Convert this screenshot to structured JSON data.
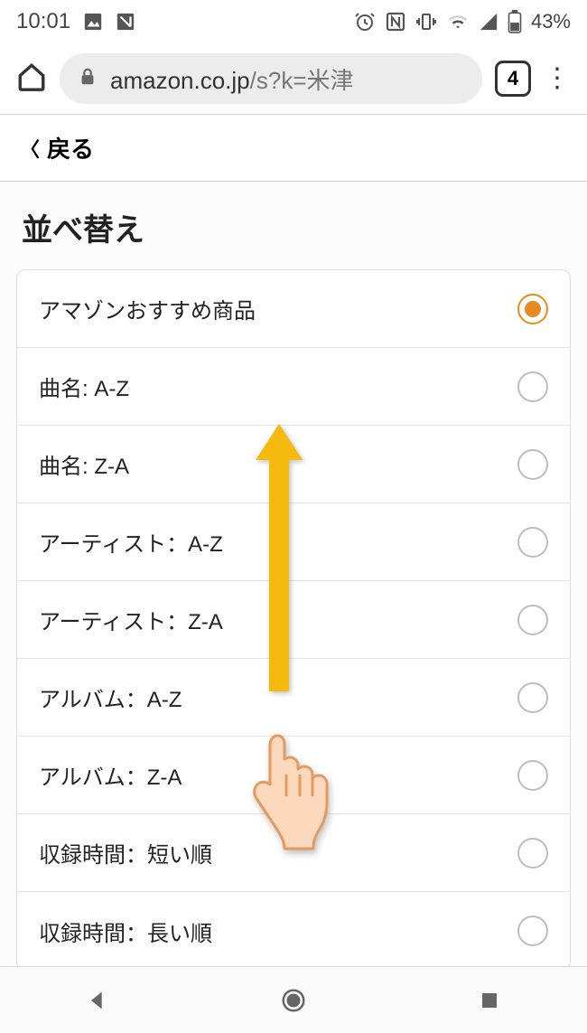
{
  "status": {
    "time": "10:01",
    "battery_pct": "43%"
  },
  "chrome": {
    "url_host": "amazon.co.jp",
    "url_path": "/s?k=米津",
    "tab_count": "4"
  },
  "back": {
    "label": "戻る"
  },
  "page": {
    "title": "並べ替え"
  },
  "options": [
    {
      "label": "アマゾンおすすめ商品",
      "selected": true
    },
    {
      "label": "曲名: A-Z",
      "selected": false
    },
    {
      "label": "曲名: Z-A",
      "selected": false
    },
    {
      "label": "アーティスト：A-Z",
      "selected": false
    },
    {
      "label": "アーティスト：Z-A",
      "selected": false
    },
    {
      "label": "アルバム：A-Z",
      "selected": false
    },
    {
      "label": "アルバム：Z-A",
      "selected": false
    },
    {
      "label": "収録時間：短い順",
      "selected": false
    },
    {
      "label": "収録時間：長い順",
      "selected": false
    }
  ]
}
